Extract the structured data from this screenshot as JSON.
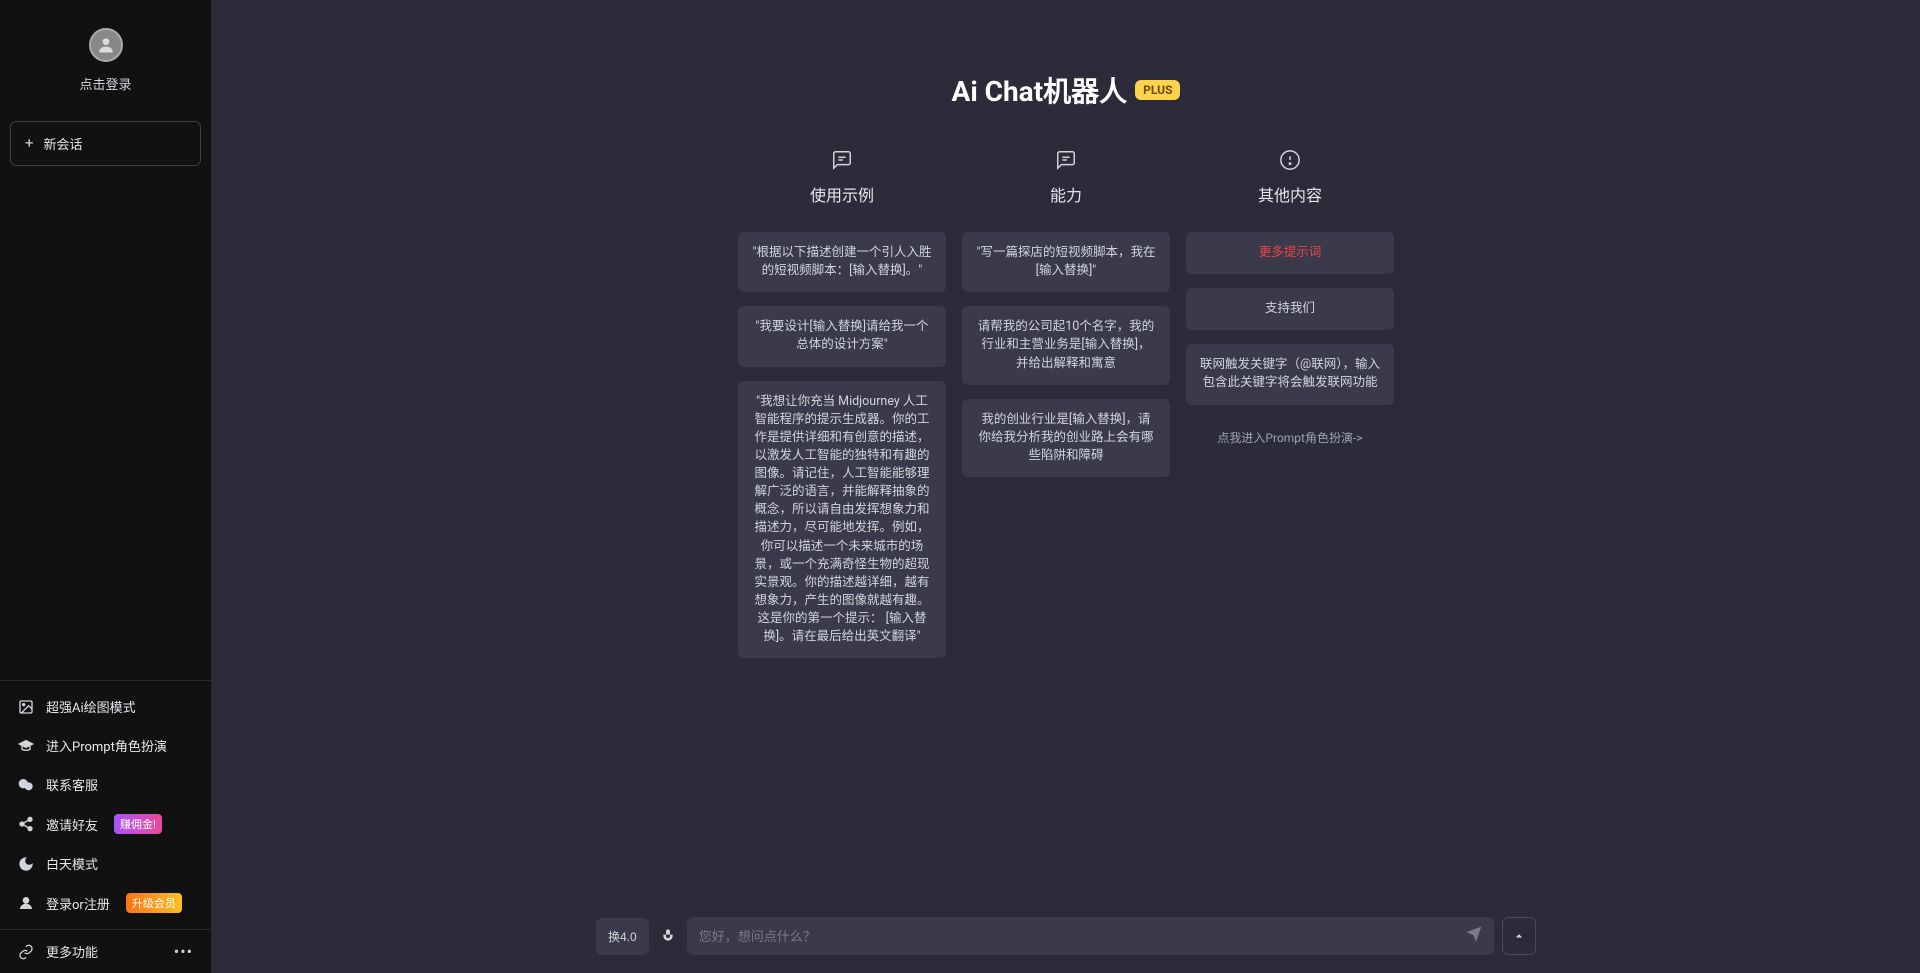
{
  "sidebar": {
    "login_text": "点击登录",
    "new_chat": "新会话",
    "menu": [
      {
        "label": "超强Ai绘图模式"
      },
      {
        "label": "进入Prompt角色扮演"
      },
      {
        "label": "联系客服"
      },
      {
        "label": "邀请好友",
        "badge": "赚佣金!"
      },
      {
        "label": "白天模式"
      },
      {
        "label": "登录or注册",
        "badge": "升级会员"
      }
    ],
    "more": "更多功能"
  },
  "header": {
    "title": "Ai Chat机器人",
    "plus_tag": "PLUS"
  },
  "columns": {
    "examples": {
      "title": "使用示例",
      "cards": [
        "\"根据以下描述创建一个引人入胜的短视频脚本：[输入替换]。\"",
        "\"我要设计[输入替换]请给我一个总体的设计方案\"",
        "\"我想让你充当 Midjourney 人工智能程序的提示生成器。你的工作是提供详细和有创意的描述，以激发人工智能的独特和有趣的图像。请记住，人工智能能够理解广泛的语言，并能解释抽象的概念，所以请自由发挥想象力和描述力，尽可能地发挥。例如，你可以描述一个未来城市的场景，或一个充满奇怪生物的超现实景观。你的描述越详细，越有想象力，产生的图像就越有趣。这是你的第一个提示： [输入替换]。请在最后给出英文翻译\""
      ]
    },
    "abilities": {
      "title": "能力",
      "cards": [
        "\"写一篇探店的短视频脚本，我在[输入替换]\"",
        "请帮我的公司起10个名字，我的行业和主营业务是[输入替换]，并给出解释和寓意",
        "我的创业行业是[输入替换]，请你给我分析我的创业路上会有哪些陷阱和障碍"
      ]
    },
    "other": {
      "title": "其他内容",
      "cards": [
        {
          "text": "更多提示词",
          "red": true
        },
        {
          "text": "支持我们",
          "red": false
        },
        {
          "text": "联网触发关键字（@联网），输入包含此关键字将会触发联网功能",
          "red": false
        }
      ],
      "prompt_link": "点我进入Prompt角色扮演->"
    }
  },
  "input": {
    "swap_button": "换4.0",
    "placeholder": "您好，想问点什么？"
  }
}
